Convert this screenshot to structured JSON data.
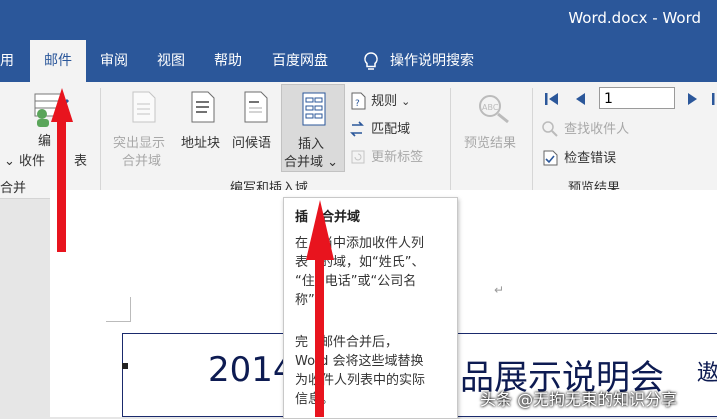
{
  "window": {
    "title": "Word.docx  -  Word"
  },
  "tabs": [
    {
      "label": "用"
    },
    {
      "label": "邮件"
    },
    {
      "label": "审阅"
    },
    {
      "label": "视图"
    },
    {
      "label": "帮助"
    },
    {
      "label": "百度网盘"
    },
    {
      "label": "操作说明搜索"
    }
  ],
  "ribbon": {
    "edit_recipients": {
      "line1": "编",
      "line2": "收件",
      "line2b": "表"
    },
    "start_group_label": "合并",
    "highlight_fields": {
      "line1": "突出显示",
      "line2": "合并域"
    },
    "address_block": "地址块",
    "greeting_line": "问候语",
    "insert_field": {
      "line1": "插入",
      "line2": "合并域"
    },
    "rules": "规则",
    "match_fields": "匹配域",
    "update_labels": "更新标签",
    "write_group_label": "编写和插入域",
    "preview_results": "预览结果",
    "record_number": "1",
    "find_recipient": "查找收件人",
    "check_errors": "检查错误",
    "preview_group_label": "预览结果"
  },
  "tooltip": {
    "title_a": "插",
    "title_b": "合并域",
    "para1_l1": "在",
    "para1_l1b": "当中添加收件人列",
    "para1_l2": "表",
    "para1_l2b": "的域，如“姓氏”、",
    "para1_l3": "“住",
    "para1_l3b": "电话”或“公司名",
    "para1_l4": "称”",
    "para2_l1": "完",
    "para2_l1b": "邮件合并后，",
    "para2_l2": "Word 会将这些域替换",
    "para2_l3": "为收件人列表中的实际",
    "para2_l4": "信息。"
  },
  "document": {
    "heading_left": "2014",
    "heading_right": "品展示说明会",
    "heading_edge": "遨"
  },
  "watermark": "头条 @无拘无束的知识分享",
  "colors": {
    "word_blue": "#2b579a",
    "arrow_red": "#e8141e"
  }
}
